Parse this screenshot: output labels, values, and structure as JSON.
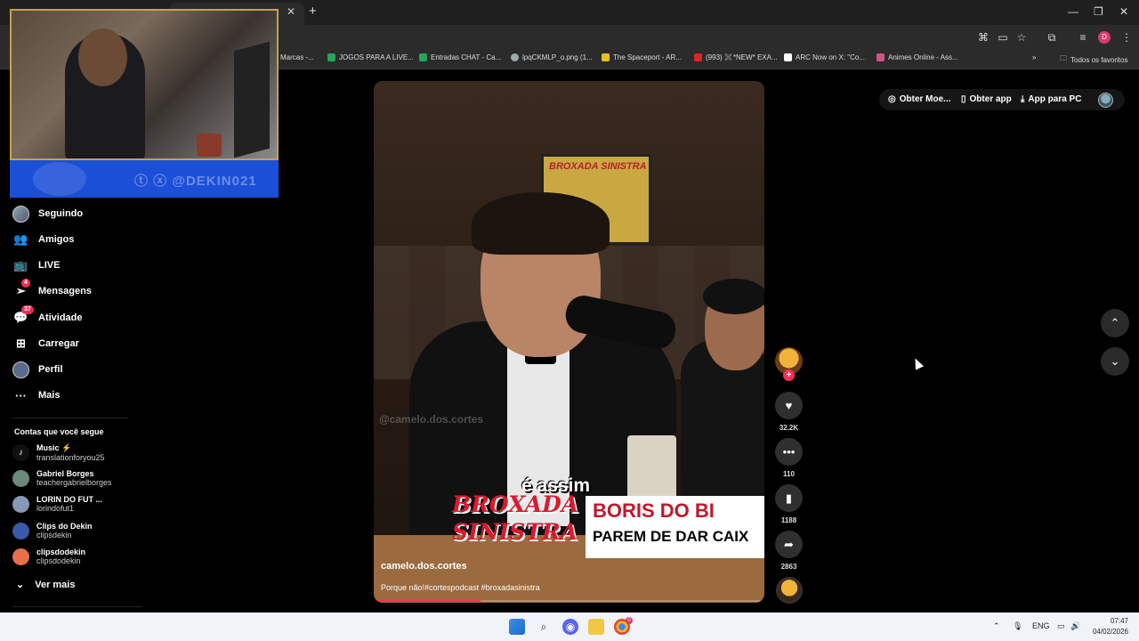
{
  "browser": {
    "bookmarks": [
      {
        "label": "Marcas -...",
        "color": "#555"
      },
      {
        "label": "JOGOS PARA A LIVE...",
        "color": "#23a55a"
      },
      {
        "label": "Entradas CHAT - Ca...",
        "color": "#23a55a"
      },
      {
        "label": "lpqCKMLP_o.png (1...",
        "color": "#9aa"
      },
      {
        "label": "The Spaceport - AR...",
        "color": "#e8c11b"
      },
      {
        "label": "(993) ✖️*NEW* EXA...",
        "color": "#e02424"
      },
      {
        "label": "ARC Now on X: \"Co...",
        "color": "#ffffff"
      },
      {
        "label": "Animes Online - Ass...",
        "color": "#c58"
      }
    ],
    "all_bookmarks_label": "Todos os favoritos",
    "profile_initial": "D"
  },
  "webcam": {
    "handle": "ⓣ ⓧ @DEKIN021"
  },
  "sidebar": {
    "items": [
      {
        "label": "Seguindo",
        "icon": "avatar-icon"
      },
      {
        "label": "Amigos",
        "icon": "friends-icon",
        "glyph": "👥"
      },
      {
        "label": "LIVE",
        "icon": "live-icon",
        "glyph": "📺"
      },
      {
        "label": "Mensagens",
        "icon": "messages-icon",
        "glyph": "➢",
        "badge": "4"
      },
      {
        "label": "Atividade",
        "icon": "activity-icon",
        "glyph": "💬",
        "badge": "37"
      },
      {
        "label": "Carregar",
        "icon": "upload-icon",
        "glyph": "⊞"
      },
      {
        "label": "Perfil",
        "icon": "profile-icon"
      },
      {
        "label": "Mais",
        "icon": "more-icon",
        "glyph": "···"
      }
    ],
    "following_title": "Contas que você segue",
    "following": [
      {
        "name": "Music ⚡",
        "handle": "translationforyou25",
        "color": "#111"
      },
      {
        "name": "Gabriel Borges",
        "handle": "teachergabrielborges",
        "color": "#6b8a7a"
      },
      {
        "name": "LORIN DO FUT ...",
        "handle": "lorindofut1",
        "color": "#8896b8"
      },
      {
        "name": "Clips do Dekin",
        "handle": "clipsdekin",
        "color": "#3a5aa8"
      },
      {
        "name": "clipsdodekin",
        "handle": "clipsdodekin",
        "color": "#e86f4a"
      }
    ],
    "see_more": "Ver mais"
  },
  "video": {
    "watermark": "@camelo.dos.cortes",
    "caption": "é assim",
    "logo_line1": "BROXADA",
    "logo_line2": "SINISTRA",
    "lower_line1": "BORIS DO BI",
    "lower_line2": "PAREM DE DAR CAIX",
    "poster_text": "BROXADA SINISTRA",
    "author": "camelo.dos.cortes",
    "description": "Porque não!#cortespodcast #broxadasinistra",
    "progress": 0.27
  },
  "actions": {
    "likes": "32.2K",
    "comments": "110",
    "saves": "1188",
    "shares": "2863"
  },
  "header": {
    "coins": "Obter Moe...",
    "get_app": "Obter app",
    "pc_app": "App para PC"
  },
  "taskbar": {
    "lang": "ENG",
    "time": "07:47",
    "date": "04/02/2026",
    "chrome_badge": "0"
  }
}
